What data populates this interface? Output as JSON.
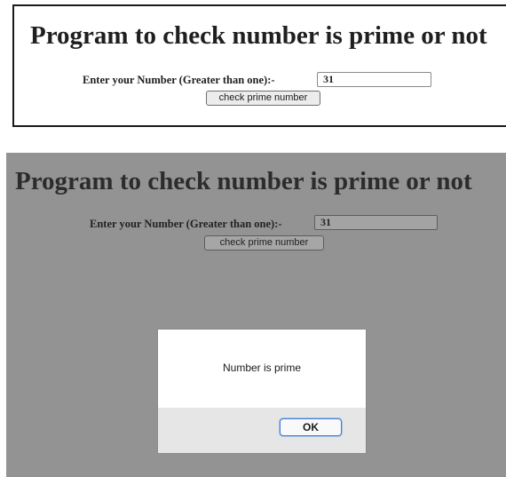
{
  "before_alert": {
    "page_title": "Program to check number is prime or not",
    "number_label": "Enter your Number (Greater than one):-",
    "number_value": "31",
    "check_button_label": "check prime number"
  },
  "with_alert": {
    "page_title": "Program to check number is prime or not",
    "number_label": "Enter your Number (Greater than one):-",
    "number_value": "31",
    "check_button_label": "check prime number",
    "overlay_color": "#939394",
    "alert": {
      "message": "Number is prime",
      "ok_label": "OK",
      "ok_focus_color": "#3d7fd6"
    }
  }
}
